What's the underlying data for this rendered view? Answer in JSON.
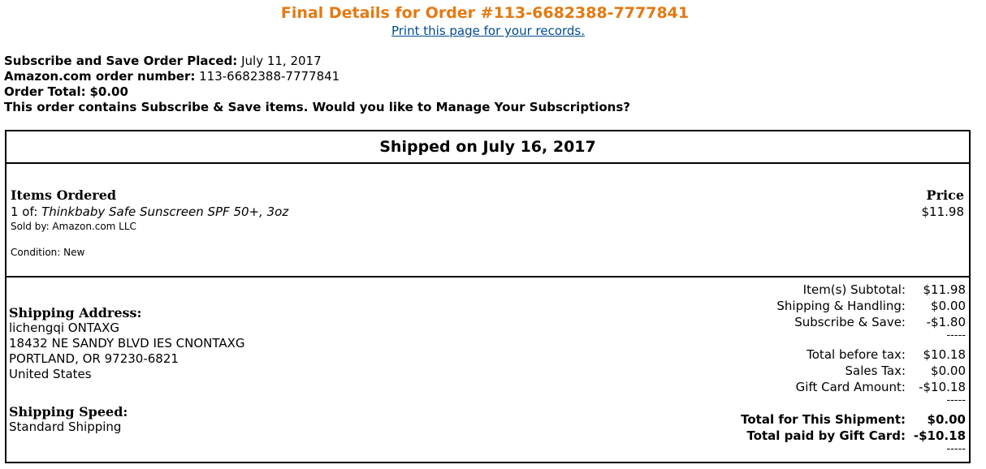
{
  "colors": {
    "title": "#e47911",
    "link": "#004b91"
  },
  "header": {
    "title": "Final Details for Order #113-6682388-7777841",
    "print_link": "Print this page for your records."
  },
  "summary": {
    "placed_label": "Subscribe and Save Order Placed:",
    "placed_value": "July 11, 2017",
    "order_number_label": "Amazon.com order number:",
    "order_number_value": "113-6682388-7777841",
    "order_total_label": "Order Total:",
    "order_total_value": "$0.00",
    "subscription_note": "This order contains Subscribe & Save items. Would you like to Manage Your Subscriptions?"
  },
  "shipment": {
    "heading": "Shipped on July 16, 2017",
    "items_label": "Items Ordered",
    "price_label": "Price",
    "item_qty": "1 of:",
    "item_name": "Thinkbaby Safe Sunscreen SPF 50+, 3oz",
    "item_price": "$11.98",
    "sold_by": "Sold by: Amazon.com LLC",
    "condition": "Condition: New"
  },
  "shipping": {
    "address_label": "Shipping Address:",
    "address_lines": [
      "lichengqi ONTAXG",
      "18432 NE SANDY BLVD IES CNONTAXG",
      "PORTLAND, OR 97230-6821",
      "United States"
    ],
    "speed_label": "Shipping Speed:",
    "speed_value": "Standard Shipping"
  },
  "totals": {
    "subtotal_label": "Item(s) Subtotal:",
    "subtotal_value": "$11.98",
    "shipping_label": "Shipping & Handling:",
    "shipping_value": "$0.00",
    "subscribe_label": "Subscribe & Save:",
    "subscribe_value": "-$1.80",
    "before_tax_label": "Total before tax:",
    "before_tax_value": "$10.18",
    "sales_tax_label": "Sales Tax:",
    "sales_tax_value": "$0.00",
    "gift_card_label": "Gift Card Amount:",
    "gift_card_value": "-$10.18",
    "shipment_total_label": "Total for This Shipment:",
    "shipment_total_value": "$0.00",
    "gift_paid_label": "Total paid by Gift Card:",
    "gift_paid_value": "-$10.18",
    "separator": "-----"
  }
}
